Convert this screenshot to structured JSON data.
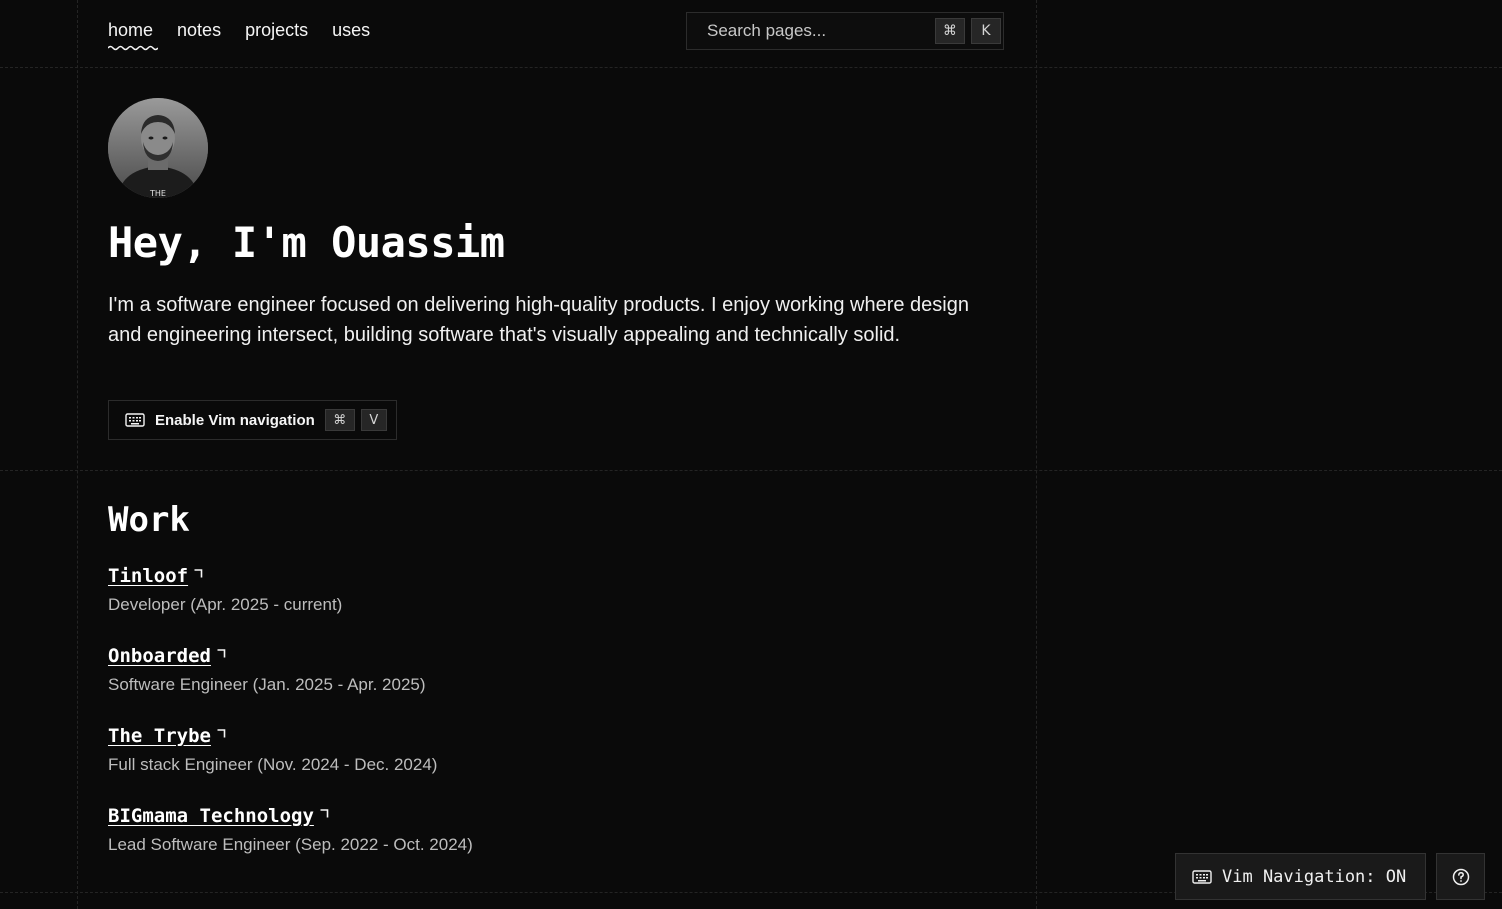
{
  "nav": {
    "items": [
      {
        "label": "home",
        "active": true
      },
      {
        "label": "notes",
        "active": false
      },
      {
        "label": "projects",
        "active": false
      },
      {
        "label": "uses",
        "active": false
      }
    ]
  },
  "search": {
    "placeholder": "Search pages...",
    "shortcut": [
      "⌘",
      "K"
    ]
  },
  "profile": {
    "avatar_icon": "person-photo",
    "avatar_shirt_text": "THE"
  },
  "hero": {
    "title": "Hey, I'm Ouassim",
    "description": "I'm a software engineer focused on delivering high-quality products. I enjoy working where design and engineering intersect, building software that's visually appealing and technically solid."
  },
  "vim_button": {
    "icon": "keyboard-icon",
    "label": "Enable Vim navigation",
    "shortcut": [
      "⌘",
      "V"
    ]
  },
  "work": {
    "title": "Work",
    "jobs": [
      {
        "company": "Tinloof",
        "role": "Developer (Apr. 2025 - current)"
      },
      {
        "company": "Onboarded",
        "role": "Software Engineer (Jan. 2025 - Apr. 2025)"
      },
      {
        "company": "The Trybe",
        "role": "Full stack Engineer (Nov. 2024 - Dec. 2024)"
      },
      {
        "company": "BIGmama Technology",
        "role": "Lead Software Engineer (Sep. 2022 - Oct. 2024)"
      }
    ]
  },
  "vim_status": {
    "icon": "keyboard-icon",
    "label": "Vim Navigation: ON"
  },
  "help": {
    "icon": "help-circle-icon"
  },
  "colors": {
    "background": "#0a0a0a",
    "text": "#f5f5f5",
    "muted": "#bdbdbd",
    "border": "#2c2c2c"
  }
}
